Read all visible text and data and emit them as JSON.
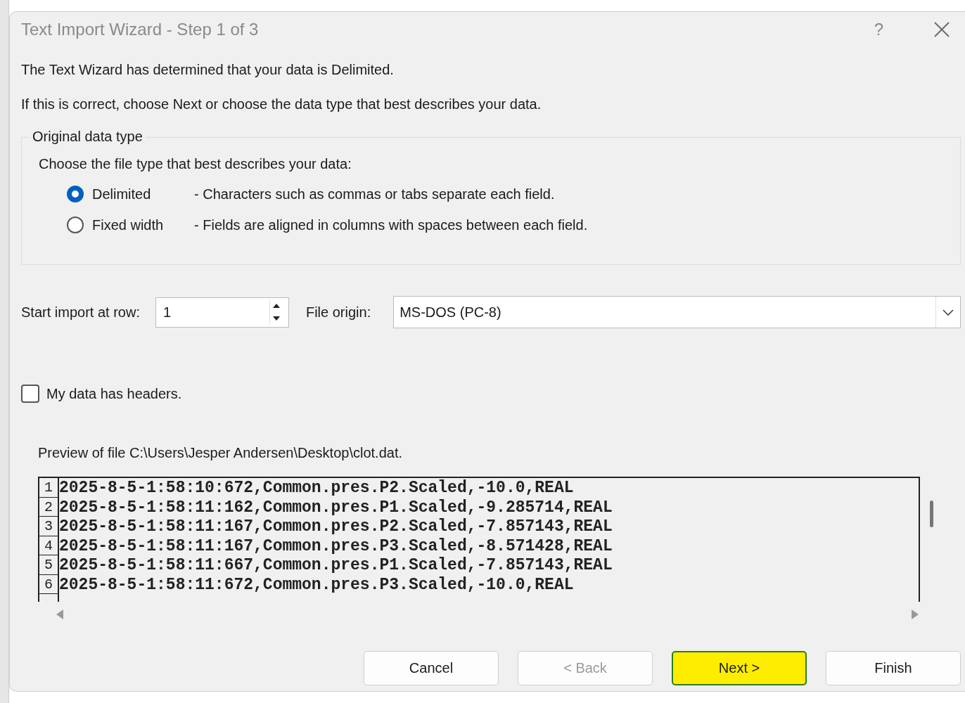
{
  "window": {
    "title": "Text Import Wizard - Step 1 of 3",
    "help_glyph": "?"
  },
  "intro": [
    "The Text Wizard has determined that your data is Delimited.",
    "If this is correct, choose Next or choose the data type that best describes your data."
  ],
  "data_type_group": {
    "legend": "Original data type",
    "prompt": "Choose the file type that best describes your data:",
    "options": [
      {
        "label": "Delimited",
        "description": "- Characters such as commas or tabs separate each field.",
        "selected": true
      },
      {
        "label": "Fixed width",
        "description": "- Fields are aligned in columns with spaces between each field.",
        "selected": false
      }
    ]
  },
  "start_row": {
    "label": "Start import at row:",
    "value": "1"
  },
  "file_origin": {
    "label": "File origin:",
    "value": "MS-DOS (PC-8)"
  },
  "headers_checkbox": {
    "label": "My data has headers.",
    "checked": false
  },
  "preview": {
    "label": "Preview of file C:\\Users\\Jesper Andersen\\Desktop\\clot.dat.",
    "rows": [
      {
        "number": "1",
        "text": "2025-8-5-1:58:10:672,Common.pres.P2.Scaled,-10.0,REAL"
      },
      {
        "number": "2",
        "text": "2025-8-5-1:58:11:162,Common.pres.P1.Scaled,-9.285714,REAL"
      },
      {
        "number": "3",
        "text": "2025-8-5-1:58:11:167,Common.pres.P2.Scaled,-7.857143,REAL"
      },
      {
        "number": "4",
        "text": "2025-8-5-1:58:11:167,Common.pres.P3.Scaled,-8.571428,REAL"
      },
      {
        "number": "5",
        "text": "2025-8-5-1:58:11:667,Common.pres.P1.Scaled,-7.857143,REAL"
      },
      {
        "number": "6",
        "text": "2025-8-5-1:58:11:672,Common.pres.P3.Scaled,-10.0,REAL"
      }
    ]
  },
  "buttons": [
    {
      "label": "Cancel",
      "disabled": false,
      "default": false,
      "highlighted": false
    },
    {
      "label": "< Back",
      "disabled": true,
      "default": false,
      "highlighted": false
    },
    {
      "label": "Next >",
      "disabled": false,
      "default": true,
      "highlighted": true
    },
    {
      "label": "Finish",
      "disabled": false,
      "default": false,
      "highlighted": false
    }
  ]
}
